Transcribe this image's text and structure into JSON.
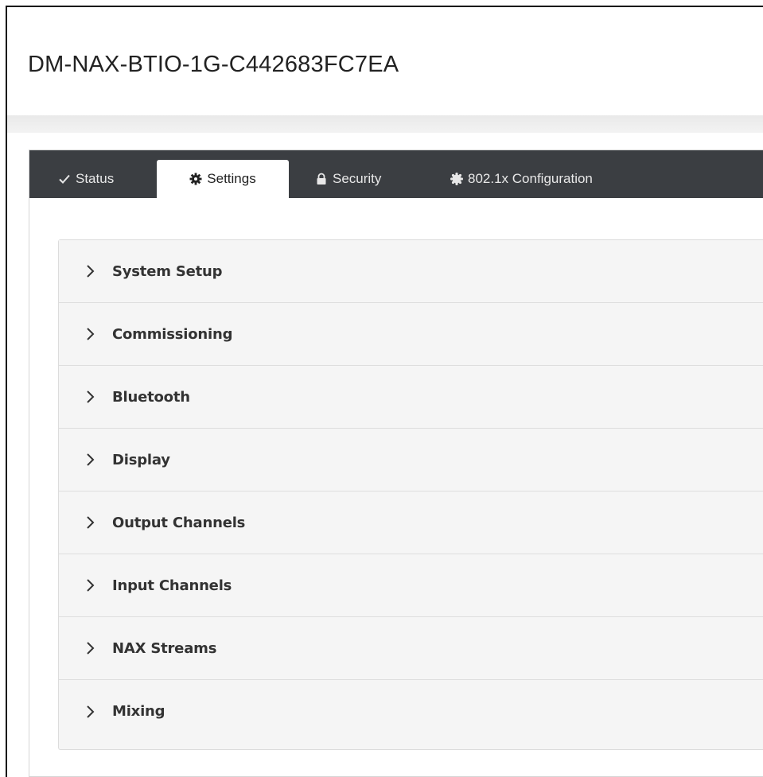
{
  "header": {
    "device_name": "DM-NAX-BTIO-1G-C442683FC7EA"
  },
  "tabs": [
    {
      "label": "Status",
      "icon": "check-icon",
      "active": false
    },
    {
      "label": "Settings",
      "icon": "gear-icon",
      "active": true
    },
    {
      "label": "Security",
      "icon": "lock-icon",
      "active": false
    },
    {
      "label": "802.1x Configuration",
      "icon": "cog-badge-icon",
      "active": false
    }
  ],
  "sections": [
    {
      "label": "System Setup"
    },
    {
      "label": "Commissioning"
    },
    {
      "label": "Bluetooth"
    },
    {
      "label": "Display"
    },
    {
      "label": "Output Channels"
    },
    {
      "label": "Input Channels"
    },
    {
      "label": "NAX Streams"
    },
    {
      "label": "Mixing"
    }
  ],
  "colors": {
    "tabbar_bg": "#3b3e42",
    "accordion_bg": "#f5f5f5",
    "active_tab_bg": "#ffffff"
  }
}
